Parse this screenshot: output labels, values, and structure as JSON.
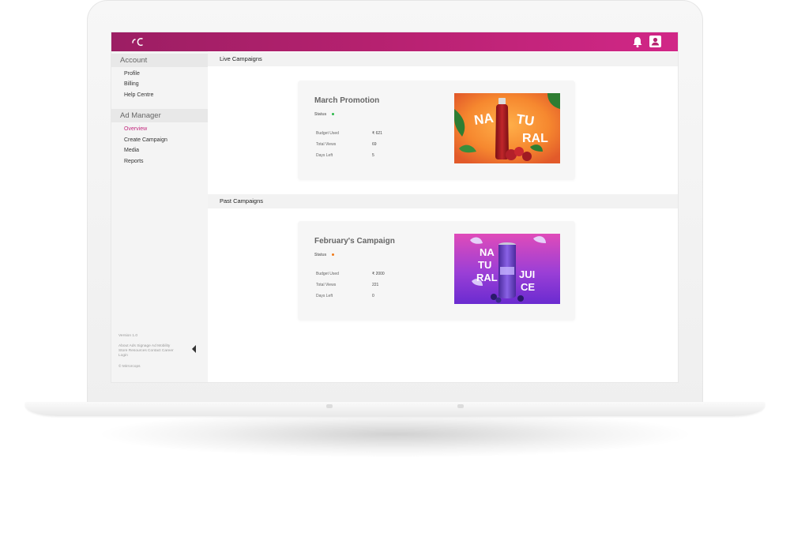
{
  "sidebar": {
    "account_heading": "Account",
    "account_items": [
      {
        "label": "Profile"
      },
      {
        "label": "Billing"
      },
      {
        "label": "Help Centre"
      }
    ],
    "ad_manager_heading": "Ad Manager",
    "ad_manager_items": [
      {
        "label": "Overview",
        "active": true
      },
      {
        "label": "Create Campaign"
      },
      {
        "label": "Media"
      },
      {
        "label": "Reports"
      }
    ],
    "version": "Version 1.0",
    "footer_links_line1": "About  Ads  Signage Ad Mobility",
    "footer_links_line2": "Store Resources  Contact  Career",
    "footer_links_line3": "Login",
    "copyright": "© Mirrorcops"
  },
  "main": {
    "live_heading": "Live Campaigns",
    "past_heading": "Past Campaigns",
    "live_campaign": {
      "title": "March Promotion",
      "status_label": "Status",
      "status_color": "#2db84b",
      "stats": [
        {
          "label": "Budget Used",
          "value": "₹ 621"
        },
        {
          "label": "Total Views",
          "value": "69"
        },
        {
          "label": "Days Left",
          "value": "5"
        }
      ],
      "image_icon": "natural-juice-red-bottle-image"
    },
    "past_campaign": {
      "title": "February's Campaign",
      "status_label": "Status",
      "status_color": "#f07a1a",
      "stats": [
        {
          "label": "Budget Used",
          "value": "₹ 2000"
        },
        {
          "label": "Total Views",
          "value": "221"
        },
        {
          "label": "Days Left",
          "value": "0"
        }
      ],
      "image_icon": "natural-juice-purple-can-image"
    }
  },
  "theme": {
    "brand_color": "#b5216f",
    "active_color": "#c2277d"
  },
  "icons": {
    "logo": "brand-logo-icon",
    "notifications": "bell-icon",
    "account": "profile-icon",
    "collapse": "collapse-arrow-icon"
  }
}
